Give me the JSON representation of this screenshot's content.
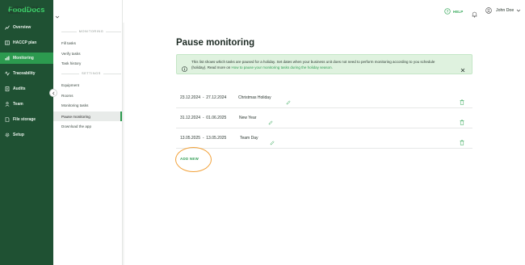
{
  "nav": {
    "logo": "FoodDocs",
    "items": [
      {
        "label": "Overview",
        "icon": "overview-icon"
      },
      {
        "label": "HACCP plan",
        "icon": "book-icon"
      },
      {
        "label": "Monitoring",
        "icon": "chart-icon"
      },
      {
        "label": "Traceability",
        "icon": "traceability-icon"
      },
      {
        "label": "Audits",
        "icon": "audit-icon"
      },
      {
        "label": "Team",
        "icon": "team-icon"
      },
      {
        "label": "File storage",
        "icon": "file-icon"
      },
      {
        "label": "Setup",
        "icon": "gear-icon"
      }
    ]
  },
  "subnav": {
    "unit_name": "FoodDocs Central Kitchen",
    "monitoring_section": "MONITORING",
    "monitoring_items": [
      "Fill tasks",
      "Verify tasks",
      "Task history"
    ],
    "settings_section": "SETTINGS",
    "settings_items": [
      "Equipment",
      "Rooms",
      "Monitoring tasks",
      "Pause monitoring",
      "Download the app"
    ]
  },
  "topbar": {
    "help_label": "HELP",
    "user_name": "John Doe"
  },
  "page": {
    "title": "Pause monitoring",
    "banner_text": "This list shows which tasks are paused for a holiday. Set dates when your business unit does not need to perform monitoring according to you schedule (holiday). Read more on ",
    "banner_link": "How to pause your monitoring tasks during the holiday season.",
    "holidays": [
      {
        "start": "23.12.2024",
        "sep": "-",
        "end": "27.12.2024",
        "name": "Christmas Holiday"
      },
      {
        "start": "31.12.2024",
        "sep": "-",
        "end": "01.06.2025",
        "name": "New Year"
      },
      {
        "start": "13.05.2025",
        "sep": "-",
        "end": "13.05.2025",
        "name": "Team Day"
      }
    ],
    "add_new_label": "ADD NEW"
  },
  "colors": {
    "nav_bg": "#1f5133",
    "nav_active": "#2c9a4f",
    "accent": "#2f9c53",
    "banner_bg": "#dff2df",
    "highlight_circle": "#f2a23b"
  }
}
